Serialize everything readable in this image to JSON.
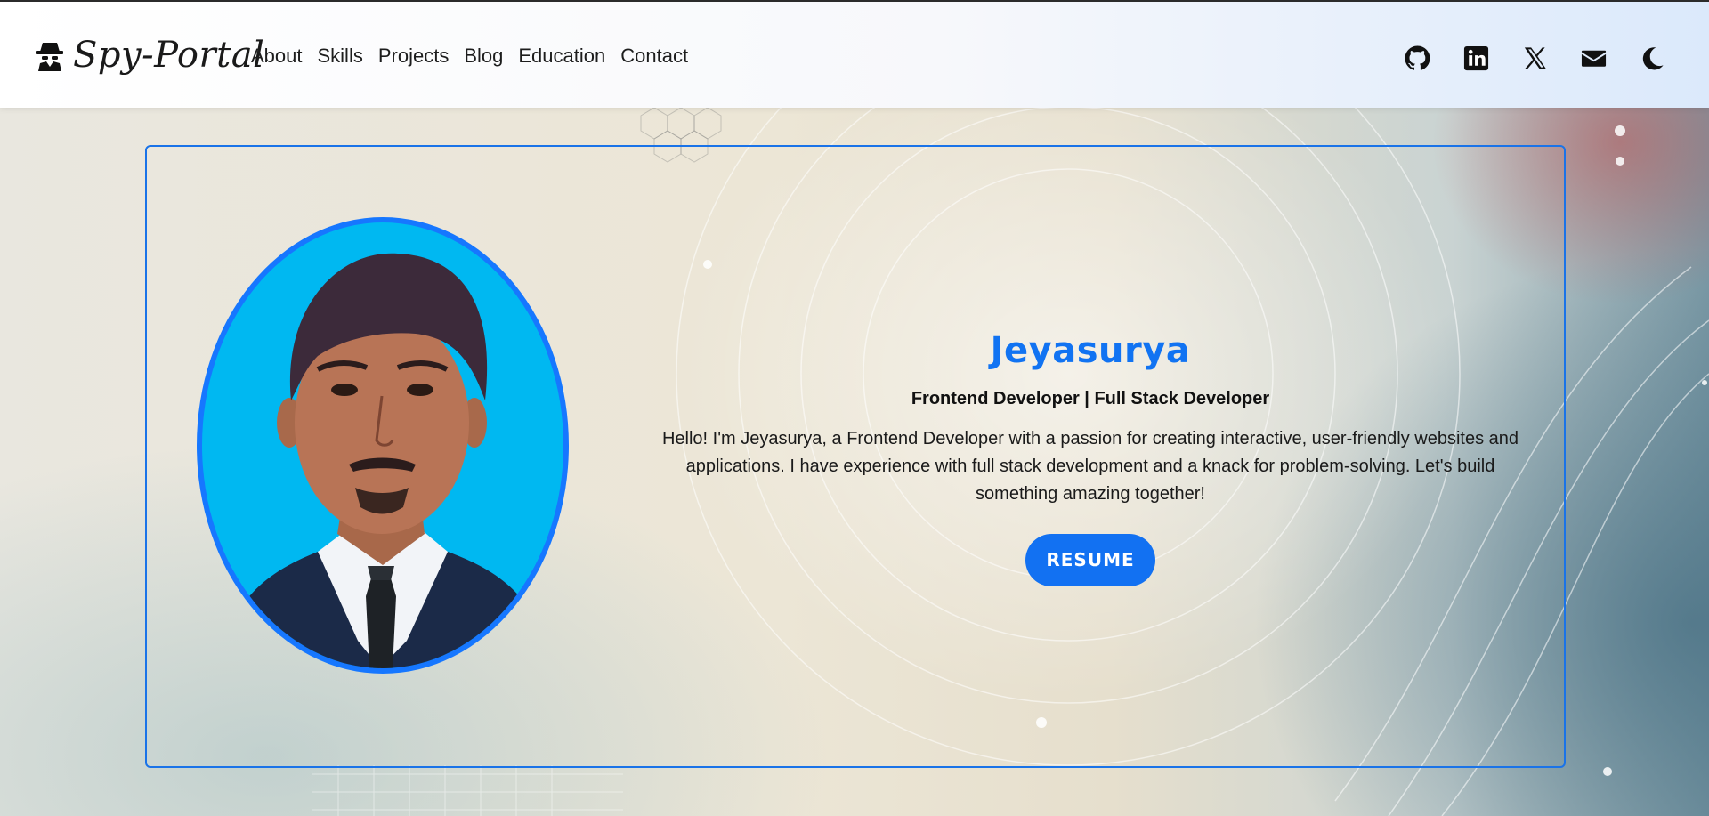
{
  "brand": {
    "name": "Spy-Portal",
    "logo_icon": "spy-icon"
  },
  "nav": {
    "links": [
      "About",
      "Skills",
      "Projects",
      "Blog",
      "Education",
      "Contact"
    ],
    "icons": [
      "github-icon",
      "linkedin-icon",
      "x-icon",
      "mail-icon",
      "moon-icon"
    ]
  },
  "hero": {
    "name": "Jeyasurya",
    "role": "Frontend Developer | Full Stack Developer",
    "bio": "Hello! I'm Jeyasurya, a Frontend Developer with a passion for creating interactive, user-friendly websites and applications. I have experience with full stack development and a knack for problem-solving. Let's build something amazing together!",
    "resume_label": "RESUME"
  },
  "colors": {
    "accent": "#1173f2",
    "card_border": "#1a73e8",
    "avatar_bg": "#00b8f1"
  }
}
